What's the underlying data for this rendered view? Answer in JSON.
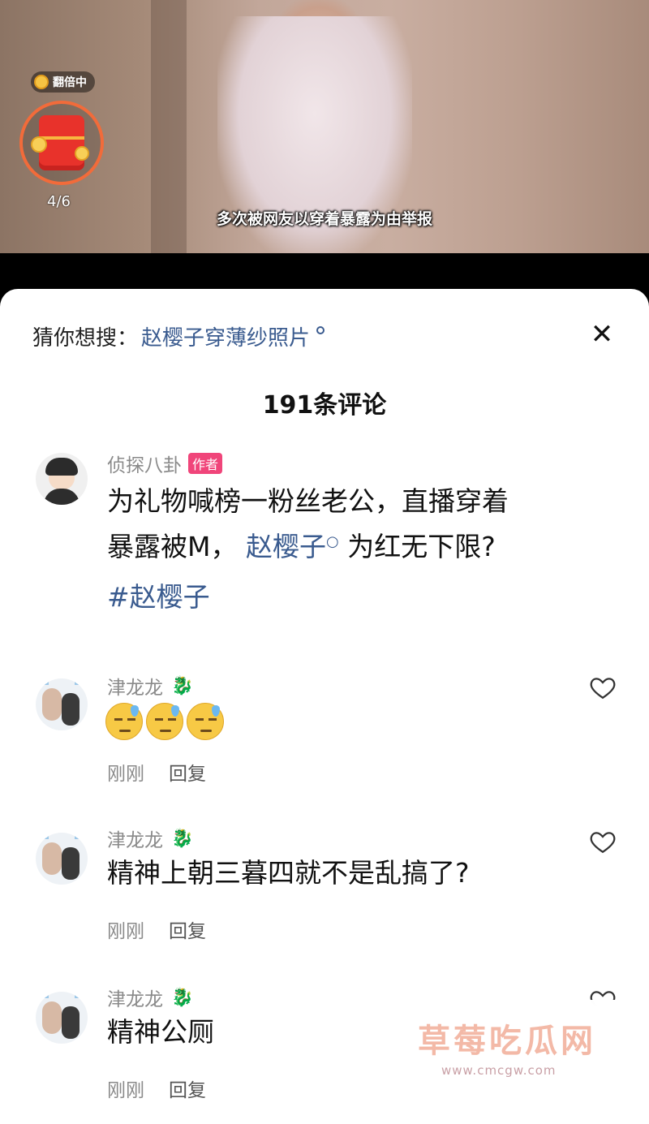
{
  "video": {
    "subtitle": "多次被网友以穿着暴露为由举报",
    "double_badge": "翻倍中",
    "redpacket_progress": "4/6"
  },
  "sheet": {
    "suggest_label": "猜你想搜：",
    "suggest_keyword": "赵樱子穿薄纱照片",
    "comment_count_title": "191条评论"
  },
  "comments": [
    {
      "username": "侦探八卦",
      "author_tag": "作者",
      "line1": "为礼物喊榜一粉丝老公，直播穿着",
      "line2_prefix": "暴露被M，",
      "line2_link": "赵樱子",
      "line2_suffix": "为红无下限?",
      "hashtag": "#赵樱子"
    },
    {
      "username": "津龙龙",
      "text": "",
      "time": "刚刚",
      "reply": "回复"
    },
    {
      "username": "津龙龙",
      "text": "精神上朝三暮四就不是乱搞了?",
      "time": "刚刚",
      "reply": "回复"
    },
    {
      "username": "津龙龙",
      "text": "精神公厕",
      "time": "刚刚",
      "reply": "回复"
    }
  ],
  "watermark": {
    "title": "草莓吃瓜网",
    "url": "www.cmcgw.com"
  },
  "colors": {
    "link": "#3a5b8f",
    "author_tag": "#f0457a",
    "redpacket": "#e8322b"
  }
}
